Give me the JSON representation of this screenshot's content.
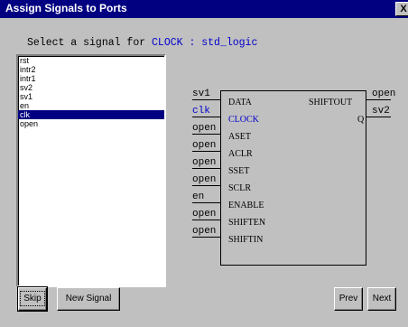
{
  "window": {
    "title": "Assign Signals to Ports",
    "close_label": "X"
  },
  "prompt": {
    "prefix": "Select a signal for ",
    "highlight": "CLOCK : std_logic"
  },
  "signal_list": {
    "items": [
      "rst",
      "intr2",
      "intr1",
      "sv2",
      "sv1",
      "en",
      "clk",
      "open"
    ],
    "selected_index": 6
  },
  "block": {
    "left_ports": [
      {
        "signal": "sv1",
        "port": "DATA",
        "active": false
      },
      {
        "signal": "clk",
        "port": "CLOCK",
        "active": true
      },
      {
        "signal": "open",
        "port": "ASET",
        "active": false
      },
      {
        "signal": "open",
        "port": "ACLR",
        "active": false
      },
      {
        "signal": "open",
        "port": "SSET",
        "active": false
      },
      {
        "signal": "open",
        "port": "SCLR",
        "active": false
      },
      {
        "signal": "en",
        "port": "ENABLE",
        "active": false
      },
      {
        "signal": "open",
        "port": "SHIFTEN",
        "active": false
      },
      {
        "signal": "open",
        "port": "SHIFTIN",
        "active": false
      }
    ],
    "right_ports": [
      {
        "signal": "open",
        "port": "SHIFTOUT"
      },
      {
        "signal": "sv2",
        "port": "Q"
      }
    ]
  },
  "buttons": {
    "skip": "Skip",
    "new_signal": "New Signal",
    "prev": "Prev",
    "next": "Next"
  },
  "colors": {
    "titlebar": "#000080",
    "highlight": "#0000cc",
    "selection": "#000080",
    "face": "#c0c0c0"
  }
}
